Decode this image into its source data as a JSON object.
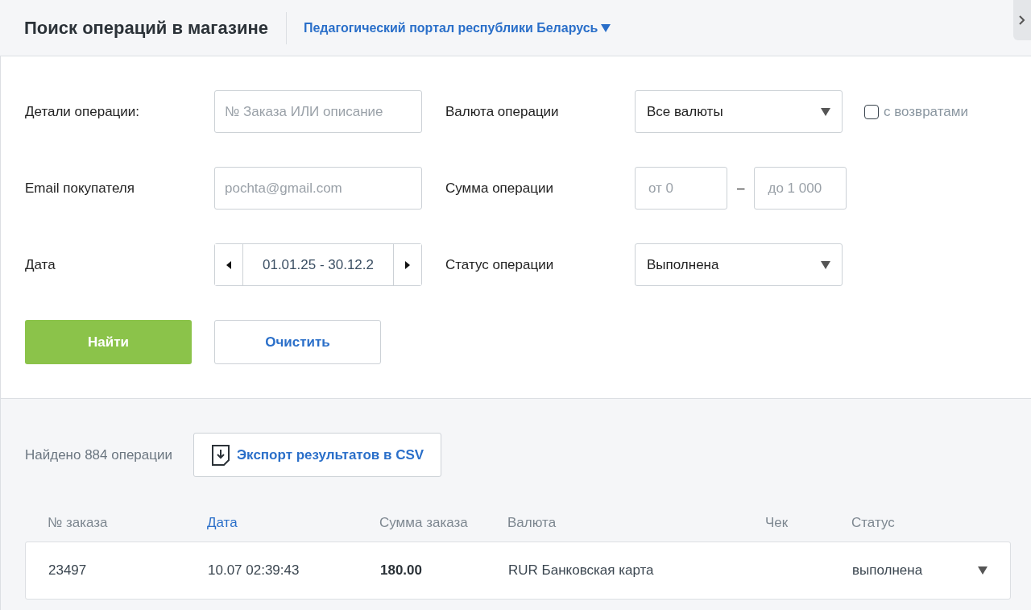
{
  "header": {
    "title": "Поиск операций в магазине",
    "shop": "Педагогический портал республики Беларусь"
  },
  "form": {
    "details": {
      "label": "Детали операции:",
      "placeholder": "№ Заказа ИЛИ описание"
    },
    "currency": {
      "label": "Валюта операции",
      "value": "Все валюты"
    },
    "refunds": {
      "label": "с возвратами",
      "checked": false
    },
    "email": {
      "label": "Email покупателя",
      "placeholder": "pochta@gmail.com"
    },
    "amount": {
      "label": "Сумма операции",
      "from_placeholder": "от 0",
      "separator": "–",
      "to_placeholder": "до 1 000"
    },
    "date": {
      "label": "Дата",
      "value": "01.01.25 - 30.12.2"
    },
    "status": {
      "label": "Статус операции",
      "value": "Выполнена"
    },
    "find_button": "Найти",
    "clear_button": "Очистить"
  },
  "results": {
    "count": "Найдено 884 операции",
    "export_button": "Экспорт результатов в CSV",
    "columns": [
      {
        "label": "№ заказа",
        "selected": false
      },
      {
        "label": "Дата",
        "selected": true
      },
      {
        "label": "Сумма заказа",
        "selected": false
      },
      {
        "label": "Валюта",
        "selected": false
      },
      {
        "label": "Чек",
        "selected": false
      },
      {
        "label": "Статус",
        "selected": false
      }
    ],
    "rows": [
      {
        "order": "23497",
        "date": "10.07 02:39:43",
        "sum": "180.00",
        "currency": "RUR Банковская карта",
        "status": "выполнена"
      }
    ]
  }
}
